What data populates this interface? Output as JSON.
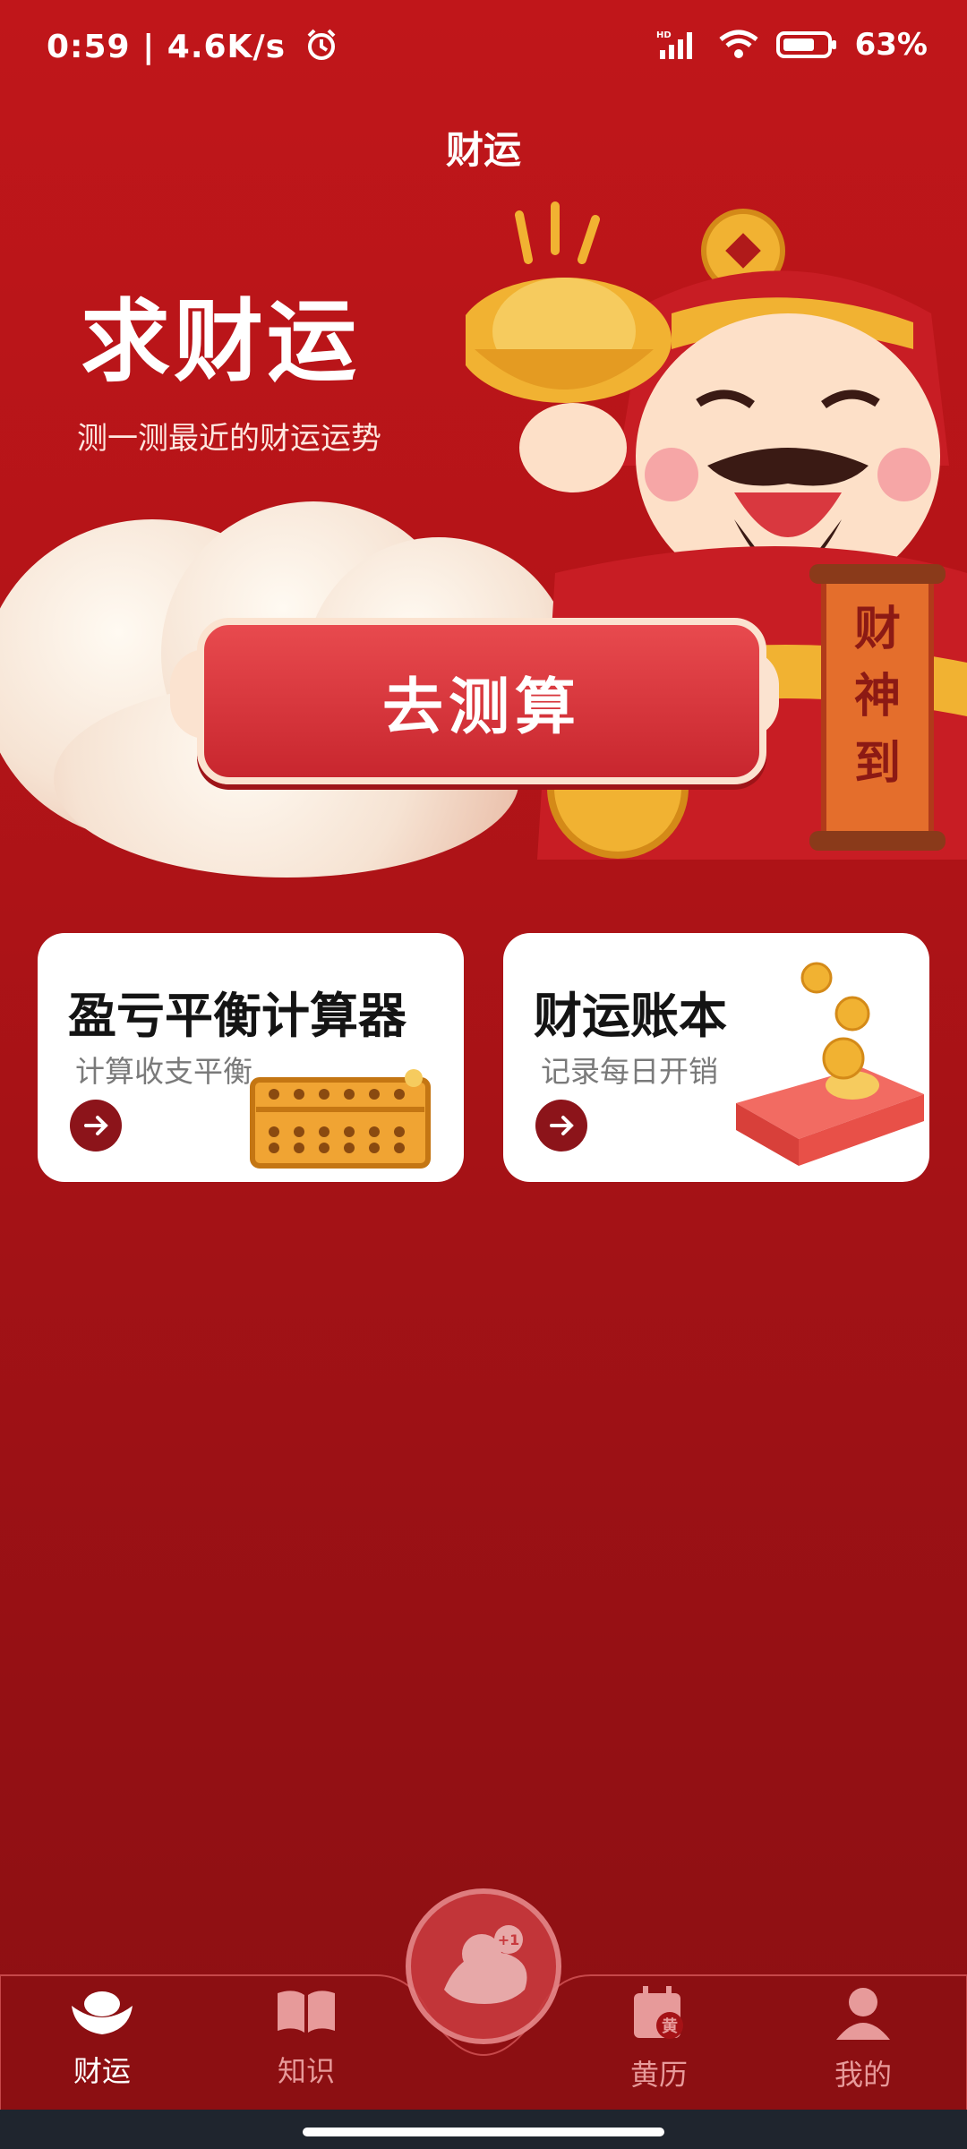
{
  "status_bar": {
    "time": "0:59",
    "speed": "4.6K/s",
    "battery": "63%",
    "icons": [
      "alarm-icon",
      "signal-icon",
      "wifi-icon",
      "battery-icon"
    ]
  },
  "header": {
    "title": "财运"
  },
  "hero": {
    "title": "求财运",
    "subtitle": "测一测最近的财运运势",
    "cta_label": "去测算",
    "scroll_text": "财神到"
  },
  "cards": [
    {
      "title": "盈亏平衡计算器",
      "subtitle": "计算收支平衡",
      "icon": "abacus-icon"
    },
    {
      "title": "财运账本",
      "subtitle": "记录每日开销",
      "icon": "ledger-book-icon"
    }
  ],
  "bottom_nav": {
    "items": [
      {
        "label": "财运",
        "icon": "ingot-icon",
        "active": true
      },
      {
        "label": "知识",
        "icon": "book-icon",
        "active": false
      },
      {
        "label": "黄历",
        "icon": "calendar-icon",
        "active": false
      },
      {
        "label": "我的",
        "icon": "profile-icon",
        "active": false
      }
    ],
    "center_badge": "+1"
  },
  "colors": {
    "primary_red": "#c0161a",
    "dark_red": "#8c141a",
    "gold": "#f1b232",
    "inactive": "#e79a9a"
  }
}
